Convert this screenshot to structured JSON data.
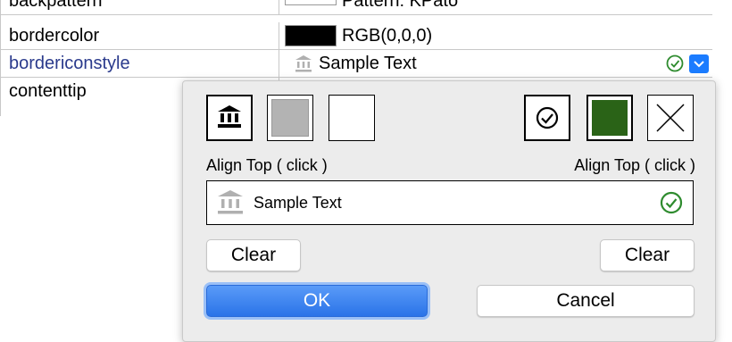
{
  "grid": {
    "rows": [
      {
        "name": "backpattern",
        "value": "Pattern: KPato"
      },
      {
        "name": "bordercolor",
        "value": "RGB(0,0,0)"
      },
      {
        "name": "bordericonstyle",
        "value": "Sample Text"
      },
      {
        "name": "contenttip",
        "value": ""
      }
    ],
    "colors": {
      "link": "#2a3a8c",
      "dropdown": "#1b7cff"
    }
  },
  "popup": {
    "left_icons": [
      "bank-icon",
      "gray-swatch",
      "empty-swatch"
    ],
    "right_icons": [
      "check-circle-icon",
      "green-swatch",
      "x-icon"
    ],
    "left_label": "Align Top ( click )",
    "right_label": "Align Top ( click )",
    "sample_text": "Sample Text",
    "clear_left": "Clear",
    "clear_right": "Clear",
    "ok": "OK",
    "cancel": "Cancel",
    "colors": {
      "green": "#2a6317",
      "gray": "#b3b3b3",
      "ok_blue": "#2f7bf0"
    }
  }
}
